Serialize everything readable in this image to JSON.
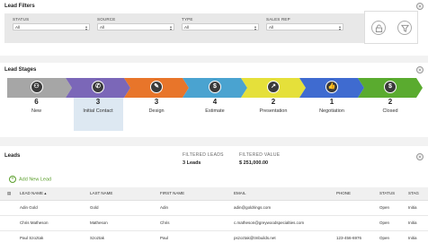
{
  "filters": {
    "title": "Lead Filters",
    "fields": [
      {
        "label": "STATUS",
        "value": "All"
      },
      {
        "label": "SOURCE",
        "value": "All"
      },
      {
        "label": "TYPE",
        "value": "All"
      },
      {
        "label": "SALES REP",
        "value": "All"
      }
    ]
  },
  "stages": {
    "title": "Lead Stages",
    "items": [
      {
        "count": "6",
        "name": "New",
        "color": "#a6a6a6",
        "icon": "user-icon",
        "glyph": "⚇"
      },
      {
        "count": "3",
        "name": "Initial Contact",
        "color": "#7b67b8",
        "icon": "phone-icon",
        "glyph": "✆"
      },
      {
        "count": "3",
        "name": "Design",
        "color": "#e8752a",
        "icon": "pencil-icon",
        "glyph": "✎"
      },
      {
        "count": "4",
        "name": "Estimate",
        "color": "#4aa3d0",
        "icon": "dollar-icon",
        "glyph": "$"
      },
      {
        "count": "2",
        "name": "Presentation",
        "color": "#e5e03a",
        "icon": "chart-icon",
        "glyph": "↗"
      },
      {
        "count": "1",
        "name": "Negotiation",
        "color": "#3f6bd0",
        "icon": "thumbs-up-icon",
        "glyph": "👍"
      },
      {
        "count": "2",
        "name": "Closed",
        "color": "#5aab2f",
        "icon": "dollar-icon",
        "glyph": "$"
      }
    ]
  },
  "leads": {
    "title": "Leads",
    "filtered_leads_label": "FILTERED LEADS",
    "filtered_leads_value": "3 Leads",
    "filtered_value_label": "FILTERED VALUE",
    "filtered_value_value": "$ 251,000.00",
    "add_label": "Add New Lead",
    "columns": [
      "LEAD NAME",
      "LAST NAME",
      "FIRST NAME",
      "EMAIL",
      "PHONE",
      "STATUS",
      "STAG"
    ],
    "rows": [
      [
        "Adin Gold",
        "Gold",
        "Adin",
        "adin@goldrings.com",
        "",
        "Open",
        "Initia"
      ],
      [
        "Chris Matheson",
        "Matheson",
        "Chris",
        "c.matheson@greywoodspecialties.com",
        "",
        "Open",
        "Initia"
      ],
      [
        "Paul Szoztak",
        "Szoztak",
        "Paul",
        "pszoztak@tmbuilds.net",
        "123-456-6976",
        "Open",
        "Initia"
      ]
    ]
  }
}
